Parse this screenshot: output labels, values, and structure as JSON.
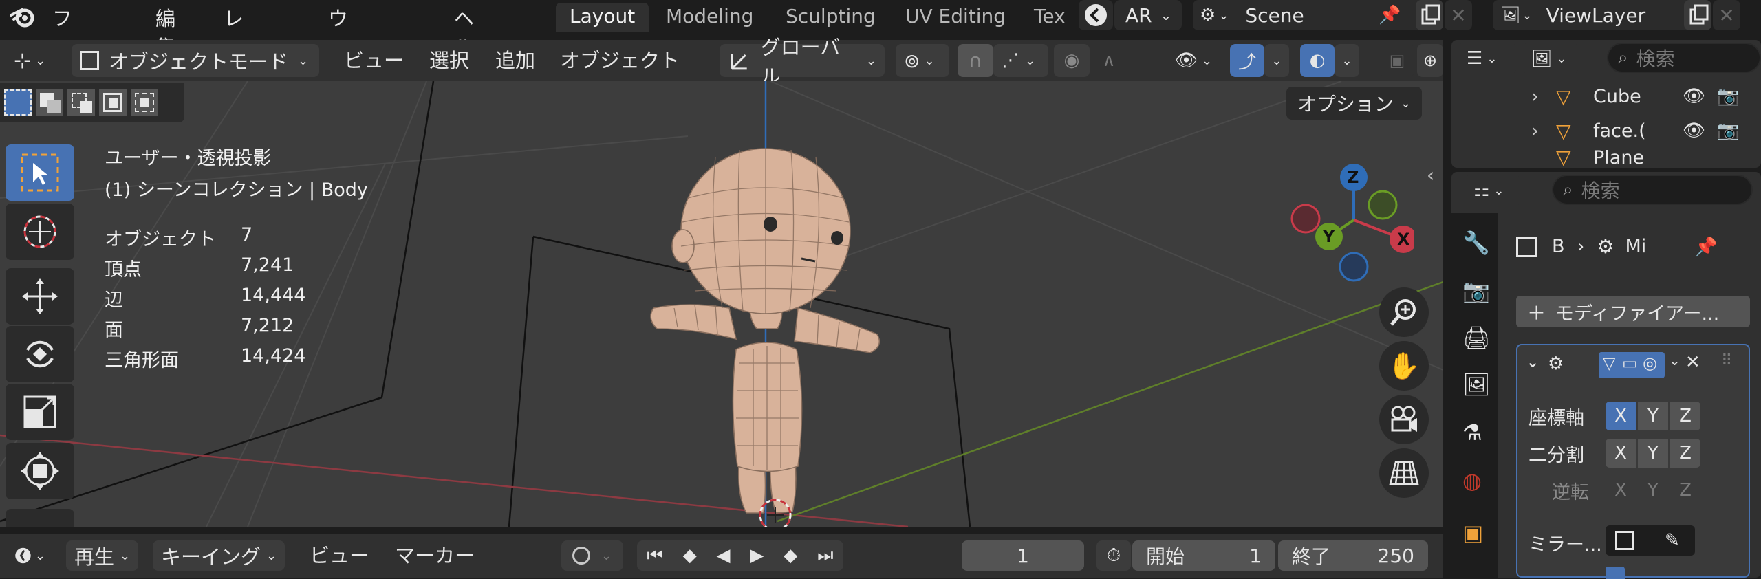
{
  "menu": {
    "items": [
      "ファイル",
      "編集",
      "レンダー",
      "ウィンドウ",
      "ヘルプ"
    ]
  },
  "workspace_tabs": [
    {
      "label": "Layout",
      "active": true
    },
    {
      "label": "Modeling",
      "active": false
    },
    {
      "label": "Sculpting",
      "active": false
    },
    {
      "label": "UV Editing",
      "active": false
    },
    {
      "label": "Tex",
      "active": false
    }
  ],
  "top_right": {
    "ar_label": "AR",
    "scene_label": "Scene",
    "view_layer_label": "ViewLayer"
  },
  "viewport_header": {
    "mode": "オブジェクトモード",
    "view": "ビュー",
    "select": "選択",
    "add": "追加",
    "object": "オブジェクト",
    "transform_orientation": "グローバル",
    "options": "オプション"
  },
  "overlay_info": {
    "view_title": "ユーザー・透視投影",
    "collection": "(1) シーンコレクション | Body",
    "stats": [
      {
        "label": "オブジェクト",
        "value": "7"
      },
      {
        "label": "頂点",
        "value": "7,241"
      },
      {
        "label": "辺",
        "value": "14,444"
      },
      {
        "label": "面",
        "value": "7,212"
      },
      {
        "label": "三角形面",
        "value": "14,424"
      }
    ]
  },
  "gizmo": {
    "z": "Z",
    "y": "Y",
    "x": "X",
    "colors": {
      "x": "#c93b4a",
      "y": "#6a9c25",
      "z": "#2f6db8"
    }
  },
  "timeline": {
    "playback": "再生",
    "keying": "キーイング",
    "view": "ビュー",
    "marker": "マーカー",
    "current_frame": "1",
    "start_label": "開始",
    "start_value": "1",
    "end_label": "終了",
    "end_value": "250"
  },
  "outliner": {
    "search_placeholder": "検索",
    "items": [
      {
        "name": "Cube"
      },
      {
        "name": "face.("
      },
      {
        "name": "Plane"
      }
    ]
  },
  "properties": {
    "search_placeholder": "検索",
    "breadcrumb_b": "B",
    "breadcrumb_mi": "Mi",
    "add_modifier": "モディファイアー...",
    "axis_label": "座標軸",
    "bisect_label": "二分割",
    "flip_label": "逆転",
    "mirror_label": "ミラー...",
    "axes": [
      "X",
      "Y",
      "Z"
    ]
  },
  "colors": {
    "accent": "#4772b3",
    "viewport_bg": "#3d3d3d",
    "mesh": "#d8b29a"
  }
}
